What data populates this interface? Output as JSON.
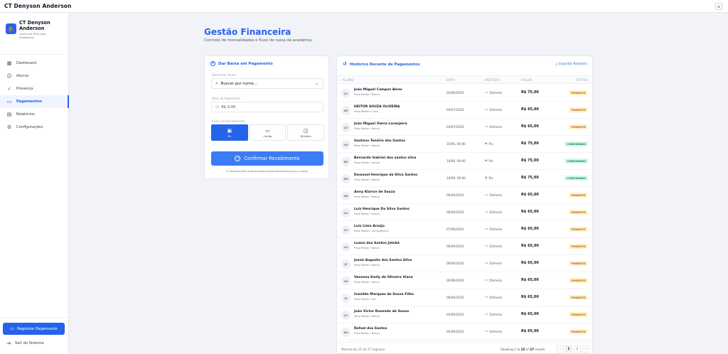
{
  "app": {
    "title": "CT Denyson Anderson"
  },
  "brand": {
    "name": "CT Denyson Anderson",
    "subtitle": "Centro de Elite para Academias"
  },
  "sidebar": {
    "items": [
      {
        "label": "Dashboard",
        "icon": "dashboard-icon"
      },
      {
        "label": "Alunos",
        "icon": "users-icon"
      },
      {
        "label": "Presença",
        "icon": "attendance-icon"
      },
      {
        "label": "Pagamentos",
        "icon": "payments-icon",
        "active": true
      },
      {
        "label": "Relatórios",
        "icon": "reports-icon"
      },
      {
        "label": "Configurações",
        "icon": "gear-icon"
      }
    ],
    "register_button": "Registrar Pagamento",
    "logout": "Sair do Sistema"
  },
  "page": {
    "title": "Gestão Financeira",
    "subtitle": "Controle de mensalidades e fluxo de caixa da academia."
  },
  "payment_form": {
    "title": "Dar Baixa em Pagamento",
    "student_label": "Selecionar Aluno",
    "student_value": "Buscar por nome...",
    "amount_label": "Valor do Pagamento",
    "amount_placeholder": "R$ 0,00",
    "method_label": "Forma de Recebimento",
    "methods": [
      {
        "label": "Pix",
        "active": true
      },
      {
        "label": "Cartão",
        "active": false
      },
      {
        "label": "Dinheiro",
        "active": false
      }
    ],
    "confirm_button": "Confirmar Recebimento",
    "note": "O comprovante será enviado automaticamente para o aluno."
  },
  "history": {
    "title": "Histórico Recente de Pagamentos",
    "export_label": "Exportar Relatório",
    "columns": [
      "ALUNO",
      "DATA",
      "MÉTODO",
      "VALOR",
      "STATUS"
    ],
    "rows": [
      {
        "initials": "JO",
        "name": "João Miguel Campos Alves",
        "plan": "Plano Padrão • Branca",
        "date": "02/06/2026",
        "method": "Dinheiro",
        "value": "R$ 75,00",
        "status": "PENDENTE",
        "status_type": "pendente"
      },
      {
        "initials": "HE",
        "name": "HEITOR SOUZA OLIVEIRA",
        "plan": "Plano Padrão • Cinza",
        "date": "04/07/2026",
        "method": "Dinheiro",
        "value": "R$ 65,00",
        "status": "PENDENTE",
        "status_type": "pendente"
      },
      {
        "initials": "JO",
        "name": "João Miguel Vieira Laranjeira",
        "plan": "Plano Padrão • Branca",
        "date": "04/07/2026",
        "method": "Dinheiro",
        "value": "R$ 65,00",
        "status": "PENDENTE",
        "status_type": "pendente"
      },
      {
        "initials": "GU",
        "name": "Gustavo Tenório dos Santos",
        "plan": "Plano Padrão • Branca",
        "date": "10/06, 00:00",
        "method": "Pix",
        "value": "R$ 75,00",
        "status": "CONFIRMADO",
        "status_type": "confirmado"
      },
      {
        "initials": "BE",
        "name": "Bernardo Gabriel dos santos silva",
        "plan": "Plano Padrão • Laranja",
        "date": "10/06, 00:00",
        "method": "Pix",
        "value": "R$ 75,00",
        "status": "CONFIRMADO",
        "status_type": "confirmado"
      },
      {
        "initials": "EM",
        "name": "Emanuel Henrique da Silva Santos",
        "plan": "Plano Padrão • Branca",
        "date": "10/06, 00:00",
        "method": "Pix",
        "value": "R$ 75,00",
        "status": "CONFIRMADO",
        "status_type": "confirmado"
      },
      {
        "initials": "AN",
        "name": "Anny Klarice de Souza",
        "plan": "Plano Padrão • Branca",
        "date": "06/06/2026",
        "method": "Dinheiro",
        "value": "R$ 65,00",
        "status": "PENDENTE",
        "status_type": "pendente"
      },
      {
        "initials": "LU",
        "name": "Luiz Henrique Da Silva Santos",
        "plan": "Plano Padrão • Branca",
        "date": "06/06/2026",
        "method": "Dinheiro",
        "value": "R$ 65,00",
        "status": "PENDENTE",
        "status_type": "pendente"
      },
      {
        "initials": "LU",
        "name": "Luis Lima Araújo",
        "plan": "Plano Padrão • Laranja/Branca",
        "date": "07/06/2026",
        "method": "Dinheiro",
        "value": "R$ 65,00",
        "status": "PENDENTE",
        "status_type": "pendente"
      },
      {
        "initials": "LU",
        "name": "Luana dos Santos Jatobá",
        "plan": "Plano Padrão • Branca",
        "date": "06/06/2026",
        "method": "Dinheiro",
        "value": "R$ 65,00",
        "status": "PENDENTE",
        "status_type": "pendente"
      },
      {
        "initials": "JE",
        "name": "Josué Augusto dos Santos Silva",
        "plan": "Plano Padrão • Branca",
        "date": "06/06/2026",
        "method": "Dinheiro",
        "value": "R$ 65,00",
        "status": "PENDENTE",
        "status_type": "pendente"
      },
      {
        "initials": "VA",
        "name": "Vanessa Emily de Oliveira Viana",
        "plan": "Plano Padrão • Branca",
        "date": "06/06/2026",
        "method": "Dinheiro",
        "value": "R$ 65,00",
        "status": "PENDENTE",
        "status_type": "pendente"
      },
      {
        "initials": "IV",
        "name": "Ivanildo Marques de Souza Filho",
        "plan": "Plano Padrão • Azul",
        "date": "06/06/2026",
        "method": "Dinheiro",
        "value": "R$ 65,00",
        "status": "PENDENTE",
        "status_type": "pendente"
      },
      {
        "initials": "JO",
        "name": "João Victor Rosendo de Souza",
        "plan": "Plano Padrão • Branca",
        "date": "05/06/2026",
        "method": "Dinheiro",
        "value": "R$ 65,00",
        "status": "PENDENTE",
        "status_type": "pendente"
      },
      {
        "initials": "RA",
        "name": "Rafael dos Santos",
        "plan": "Plano Padrão • Branca",
        "date": "05/06/2026",
        "method": "Dinheiro",
        "value": "R$ 65,00",
        "status": "PENDENTE",
        "status_type": "pendente"
      }
    ],
    "footer_left": "Mostrando 15 de 27 registros",
    "footer_prefix": "Showing 1 to",
    "footer_to": "15",
    "footer_of_text": "of",
    "footer_total": "27",
    "footer_suffix": "results",
    "pages": [
      "‹",
      "1",
      "2",
      "›"
    ]
  },
  "colors": {
    "accent": "#2563eb",
    "pending": "#b45309",
    "confirmed": "#047857"
  }
}
